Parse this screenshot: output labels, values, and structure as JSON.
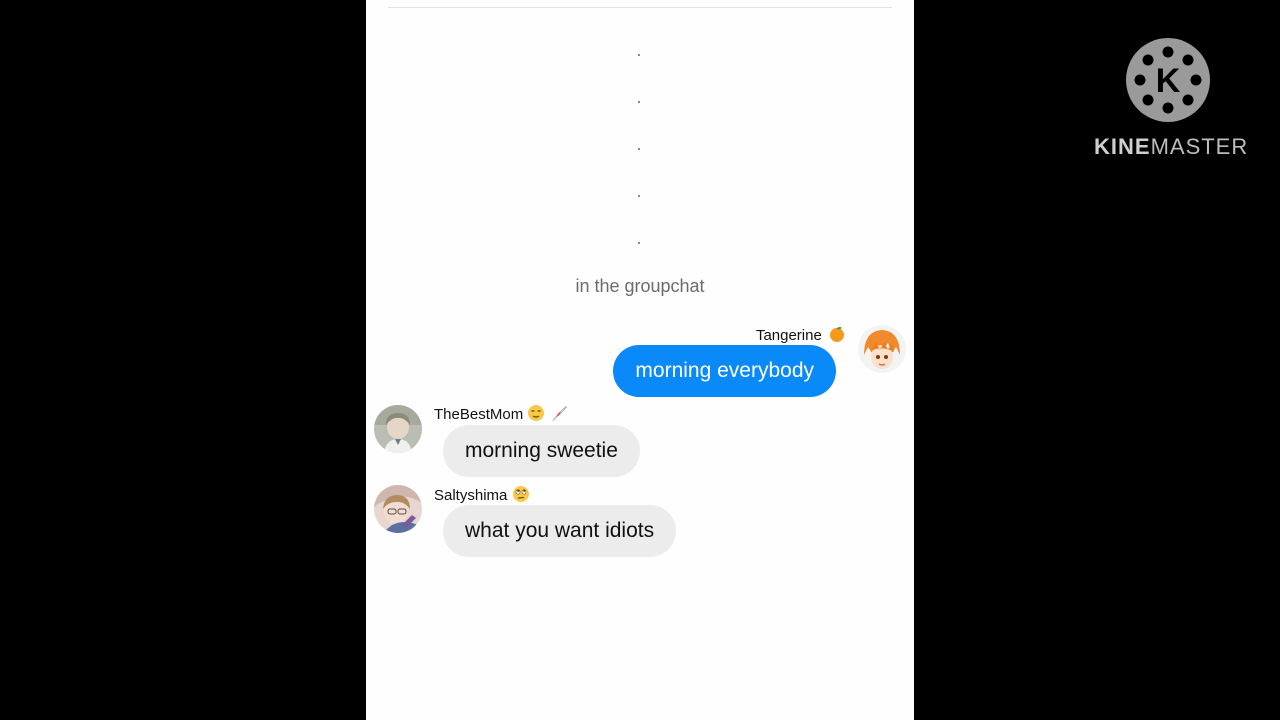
{
  "chat": {
    "dots": [
      ".",
      ".",
      ".",
      ".",
      "."
    ],
    "system_message": "in the groupchat",
    "messages": [
      {
        "sender": "Tangerine",
        "text": "morning everybody",
        "direction": "outgoing"
      },
      {
        "sender": "TheBestMom",
        "text": "morning sweetie",
        "direction": "incoming"
      },
      {
        "sender": "Saltyshima",
        "text": "what you want idiots",
        "direction": "incoming"
      }
    ]
  },
  "icons": {
    "tangerine_emoji": "tangerine-icon",
    "relieved_emoji": "relieved-face-icon",
    "syringe_emoji": "syringe-icon",
    "eye_roll_emoji": "eye-roll-face-icon"
  },
  "watermark": {
    "letter": "K",
    "brand_part1": "KINE",
    "brand_part2": "MASTER"
  },
  "colors": {
    "outgoing_bubble": "#0a8af8",
    "incoming_bubble": "#ececec",
    "background": "#000000",
    "chat_background": "#fefefe"
  }
}
